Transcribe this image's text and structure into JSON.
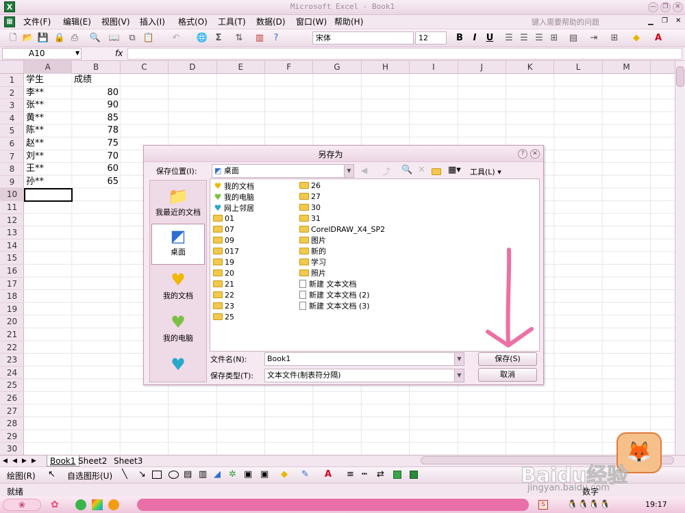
{
  "window": {
    "title": "Microsoft Excel - Book1",
    "app_icon": "X"
  },
  "menu": {
    "items": [
      "文件(F)",
      "编辑(E)",
      "视图(V)",
      "插入(I)",
      "格式(O)",
      "工具(T)",
      "数据(D)",
      "窗口(W)",
      "帮助(H)"
    ],
    "help_placeholder": "键入需要帮助的问题"
  },
  "toolbar": {
    "font_name": "宋体",
    "font_size": "12",
    "bold": "B",
    "italic": "I",
    "underline": "U",
    "sigma": "Σ"
  },
  "formula_bar": {
    "name_box": "A10",
    "fx": "fx"
  },
  "grid": {
    "columns": [
      "A",
      "B",
      "C",
      "D",
      "E",
      "F",
      "G",
      "H",
      "I",
      "J",
      "K",
      "L",
      "M"
    ],
    "rows": [
      "1",
      "2",
      "3",
      "4",
      "5",
      "6",
      "7",
      "8",
      "9",
      "10",
      "11",
      "12",
      "13",
      "14",
      "15",
      "16",
      "17",
      "18",
      "19",
      "20",
      "21",
      "22",
      "23",
      "24",
      "25",
      "26",
      "27",
      "28",
      "29",
      "30"
    ],
    "header_a": "学生",
    "header_b": "成绩",
    "records": [
      {
        "name": "李**",
        "score": "80"
      },
      {
        "name": "张**",
        "score": "90"
      },
      {
        "name": "黄**",
        "score": "85"
      },
      {
        "name": "陈**",
        "score": "78"
      },
      {
        "name": "赵**",
        "score": "75"
      },
      {
        "name": "刘**",
        "score": "70"
      },
      {
        "name": "王**",
        "score": "60"
      },
      {
        "name": "孙**",
        "score": "65"
      }
    ]
  },
  "sheets": [
    "Book1",
    "Sheet2",
    "Sheet3"
  ],
  "drawing": {
    "draw_label": "绘图(R)",
    "autoshapes_label": "自选图形(U)"
  },
  "status": {
    "ready": "就绪",
    "right_text": "数字"
  },
  "taskbar": {
    "time": "19:17"
  },
  "dialog": {
    "title": "另存为",
    "save_in_label": "保存位置(I):",
    "save_in_value": "桌面",
    "tools_label": "工具(L)",
    "places": [
      "我最近的文档",
      "桌面",
      "我的文档",
      "我的电脑"
    ],
    "files_col1": [
      {
        "name": "我的文档",
        "kind": "heart-yellow"
      },
      {
        "name": "我的电脑",
        "kind": "heart-green"
      },
      {
        "name": "网上邻居",
        "kind": "heart-blue"
      },
      {
        "name": "01",
        "kind": "folder"
      },
      {
        "name": "07",
        "kind": "folder"
      },
      {
        "name": "09",
        "kind": "folder"
      },
      {
        "name": "017",
        "kind": "folder"
      },
      {
        "name": "19",
        "kind": "folder"
      },
      {
        "name": "20",
        "kind": "folder"
      },
      {
        "name": "21",
        "kind": "folder"
      },
      {
        "name": "22",
        "kind": "folder"
      },
      {
        "name": "23",
        "kind": "folder"
      },
      {
        "name": "25",
        "kind": "folder"
      }
    ],
    "files_col2": [
      {
        "name": "26",
        "kind": "folder"
      },
      {
        "name": "27",
        "kind": "folder"
      },
      {
        "name": "30",
        "kind": "folder"
      },
      {
        "name": "31",
        "kind": "folder"
      },
      {
        "name": "CorelDRAW_X4_SP2",
        "kind": "folder"
      },
      {
        "name": "图片",
        "kind": "folder"
      },
      {
        "name": "新的",
        "kind": "folder"
      },
      {
        "name": "学习",
        "kind": "folder"
      },
      {
        "name": "照片",
        "kind": "folder"
      },
      {
        "name": "新建 文本文档",
        "kind": "doc"
      },
      {
        "name": "新建 文本文档 (2)",
        "kind": "doc"
      },
      {
        "name": "新建 文本文档 (3)",
        "kind": "doc"
      }
    ],
    "filename_label": "文件名(N):",
    "filename_value": "Book1",
    "filetype_label": "保存类型(T):",
    "filetype_value": "文本文件(制表符分隔)",
    "save_button": "保存(S)",
    "cancel_button": "取消"
  },
  "watermark": {
    "brand": "Baidu经验",
    "url": "jingyan.baidu.com"
  },
  "colors": {
    "annotation_arrow": "#ee6fa3",
    "taskbar_pill": "#e86fa8"
  }
}
